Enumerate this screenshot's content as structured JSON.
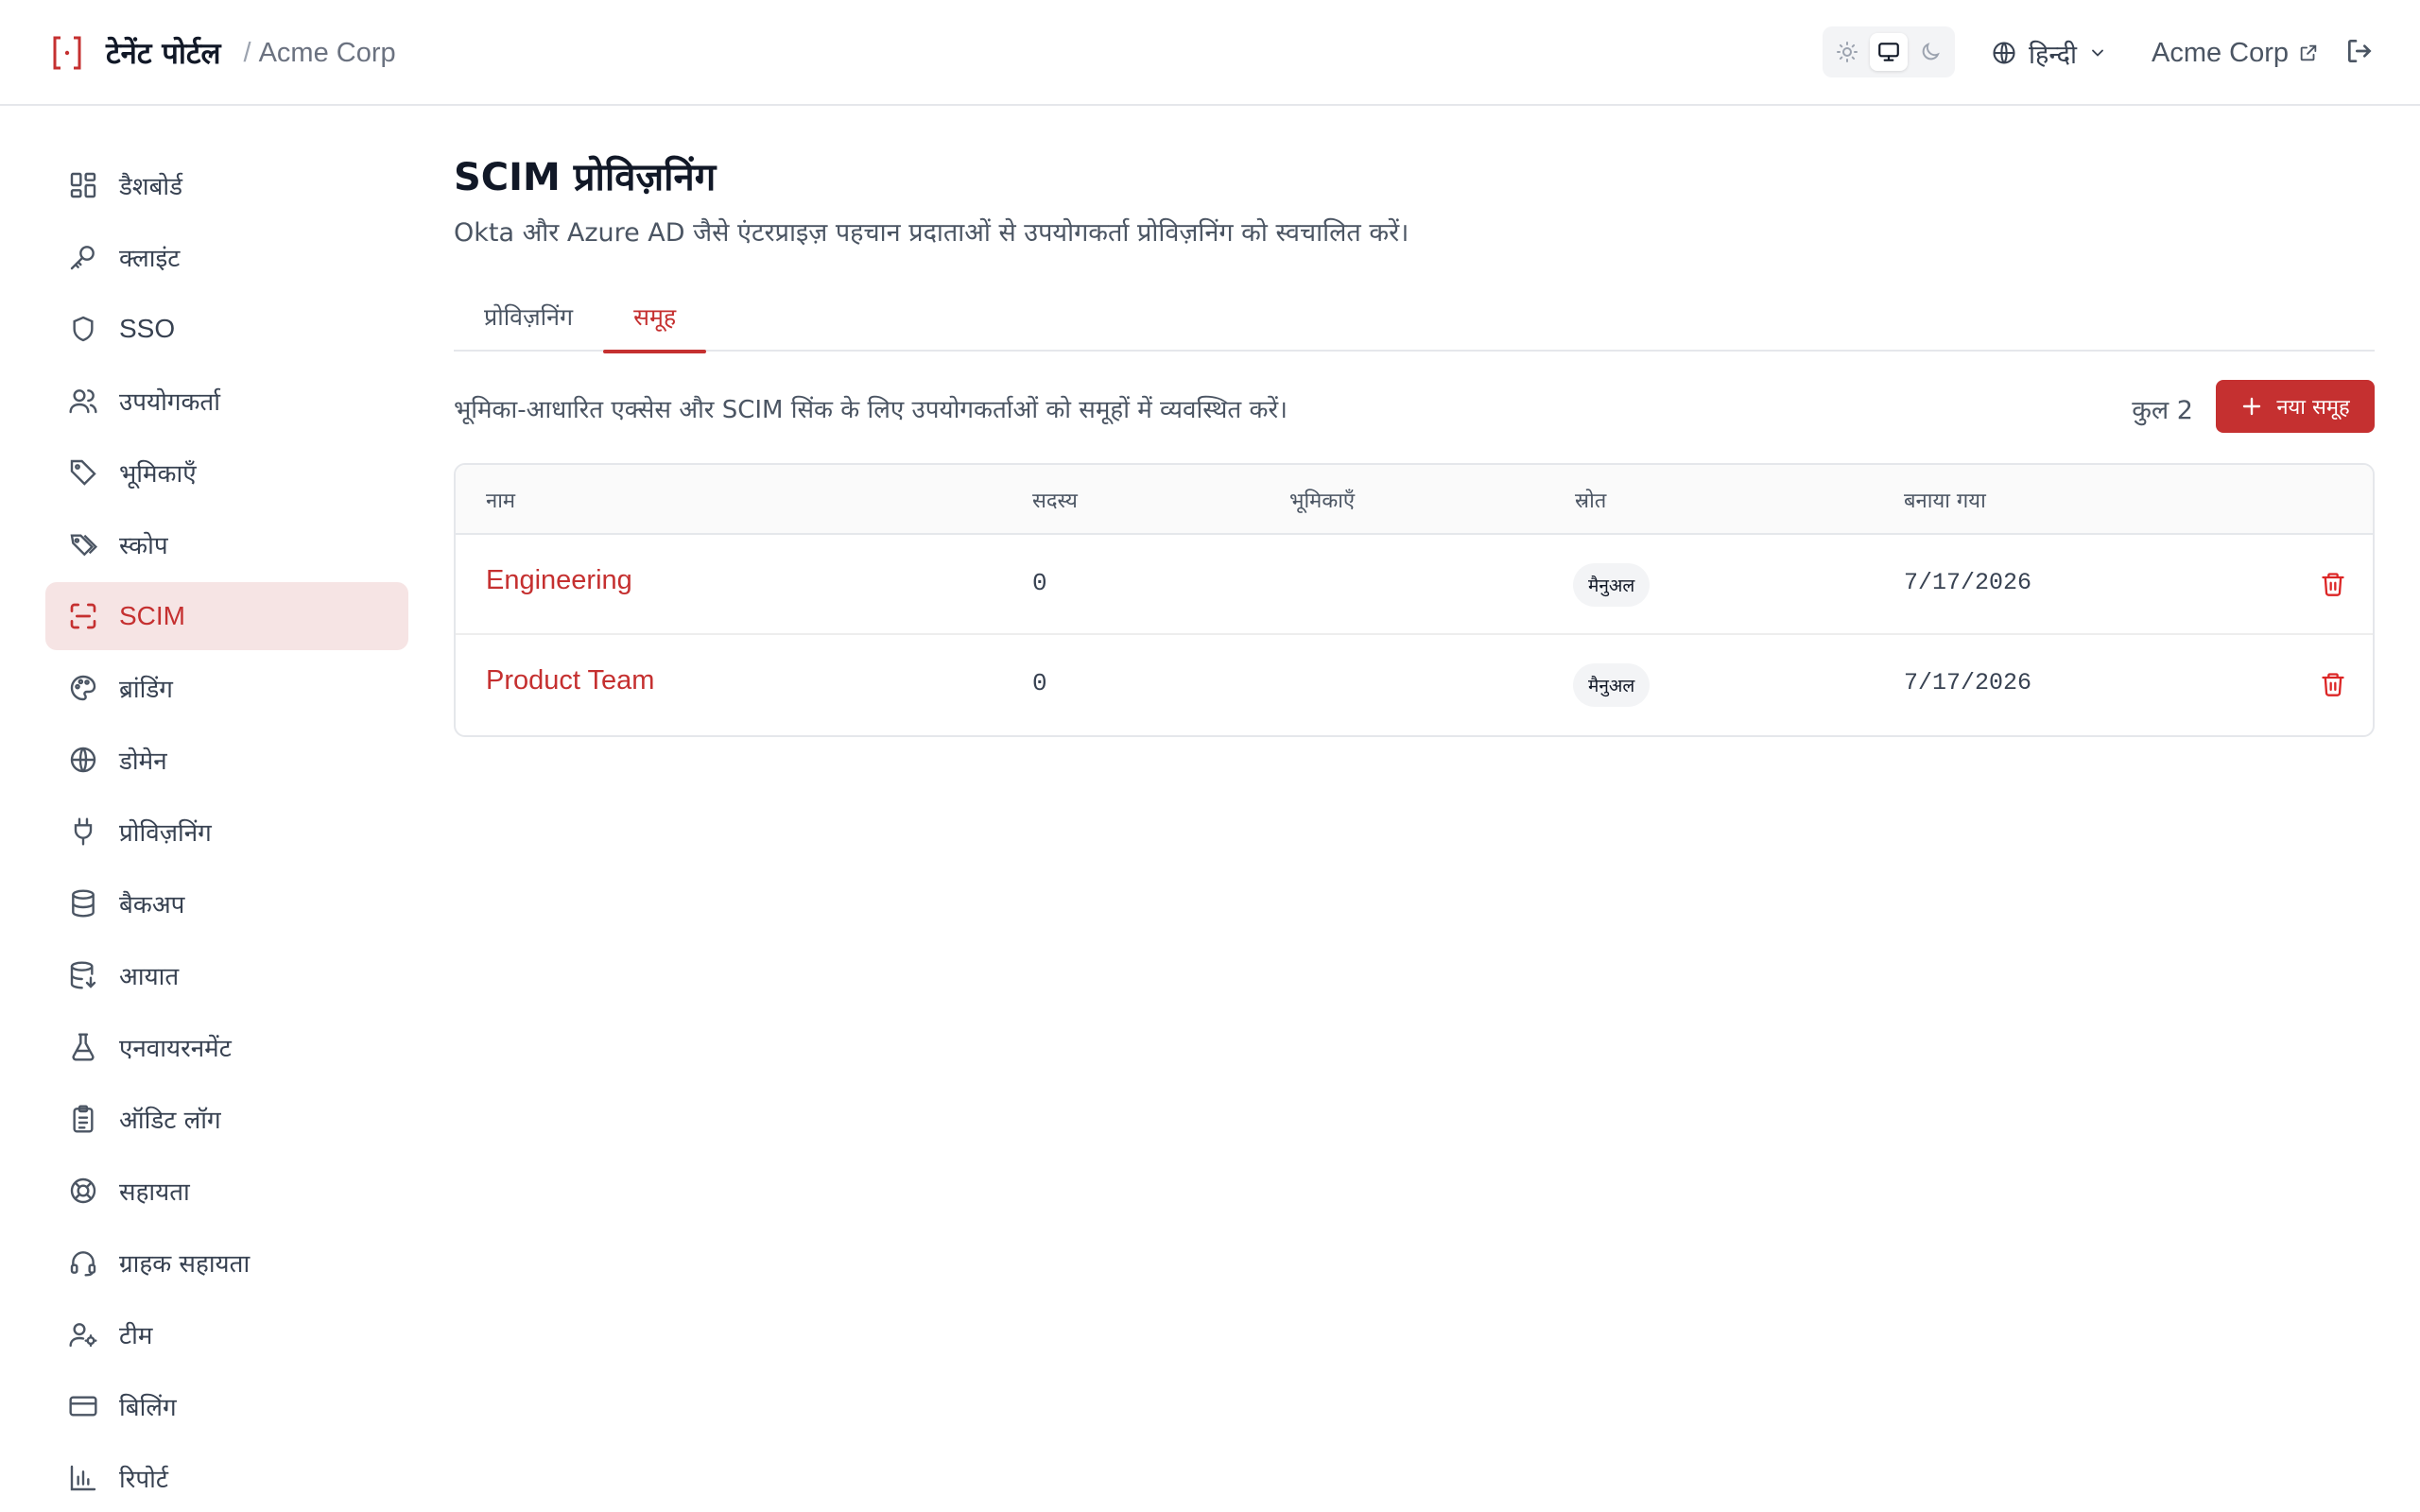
{
  "header": {
    "brand_name": "टेनेंट पोर्टल",
    "separator": "/",
    "tenant": "Acme Corp",
    "theme_options": [
      "sun-icon",
      "monitor-icon",
      "moon-icon"
    ],
    "language": "हिन्दी",
    "tenant_link": "Acme Corp"
  },
  "sidebar": {
    "items": [
      {
        "label": "डैशबोर्ड",
        "icon": "dashboard-icon"
      },
      {
        "label": "क्लाइंट",
        "icon": "key-icon"
      },
      {
        "label": "SSO",
        "icon": "shield-icon"
      },
      {
        "label": "उपयोगकर्ता",
        "icon": "users-icon"
      },
      {
        "label": "भूमिकाएँ",
        "icon": "tag-icon"
      },
      {
        "label": "स्कोप",
        "icon": "tags-icon"
      },
      {
        "label": "SCIM",
        "icon": "scan-icon",
        "active": true
      },
      {
        "label": "ब्रांडिंग",
        "icon": "palette-icon"
      },
      {
        "label": "डोमेन",
        "icon": "globe-icon"
      },
      {
        "label": "प्रोविज़निंग",
        "icon": "plug-icon"
      },
      {
        "label": "बैकअप",
        "icon": "database-icon"
      },
      {
        "label": "आयात",
        "icon": "database-import-icon"
      },
      {
        "label": "एनवायरनमेंट",
        "icon": "flask-icon"
      },
      {
        "label": "ऑडिट लॉग",
        "icon": "clipboard-icon"
      },
      {
        "label": "सहायता",
        "icon": "lifebuoy-icon"
      },
      {
        "label": "ग्राहक सहायता",
        "icon": "headset-icon"
      },
      {
        "label": "टीम",
        "icon": "user-cog-icon"
      },
      {
        "label": "बिलिंग",
        "icon": "credit-card-icon"
      },
      {
        "label": "रिपोर्ट",
        "icon": "bar-chart-icon"
      }
    ]
  },
  "main": {
    "title": "SCIM प्रोविज़निंग",
    "subtitle": "Okta और Azure AD जैसे एंटरप्राइज़ पहचान प्रदाताओं से उपयोगकर्ता प्रोविज़निंग को स्वचालित करें।",
    "tabs": [
      {
        "label": "प्रोविज़निंग",
        "active": false
      },
      {
        "label": "समूह",
        "active": true
      }
    ],
    "groups_description": "भूमिका-आधारित एक्सेस और SCIM सिंक के लिए उपयोगकर्ताओं को समूहों में व्यवस्थित करें।",
    "total_label": "कुल 2",
    "new_group_button": "नया समूह",
    "table": {
      "columns": [
        "नाम",
        "सदस्य",
        "भूमिकाएँ",
        "स्रोत",
        "बनाया गया"
      ],
      "rows": [
        {
          "name": "Engineering",
          "members": "0",
          "roles": "",
          "source": "मैनुअल",
          "created": "7/17/2026"
        },
        {
          "name": "Product Team",
          "members": "0",
          "roles": "",
          "source": "मैनुअल",
          "created": "7/17/2026"
        }
      ]
    }
  },
  "colors": {
    "accent": "#c53030",
    "active_bg": "#f6e4e4",
    "border": "#e5e7eb"
  }
}
